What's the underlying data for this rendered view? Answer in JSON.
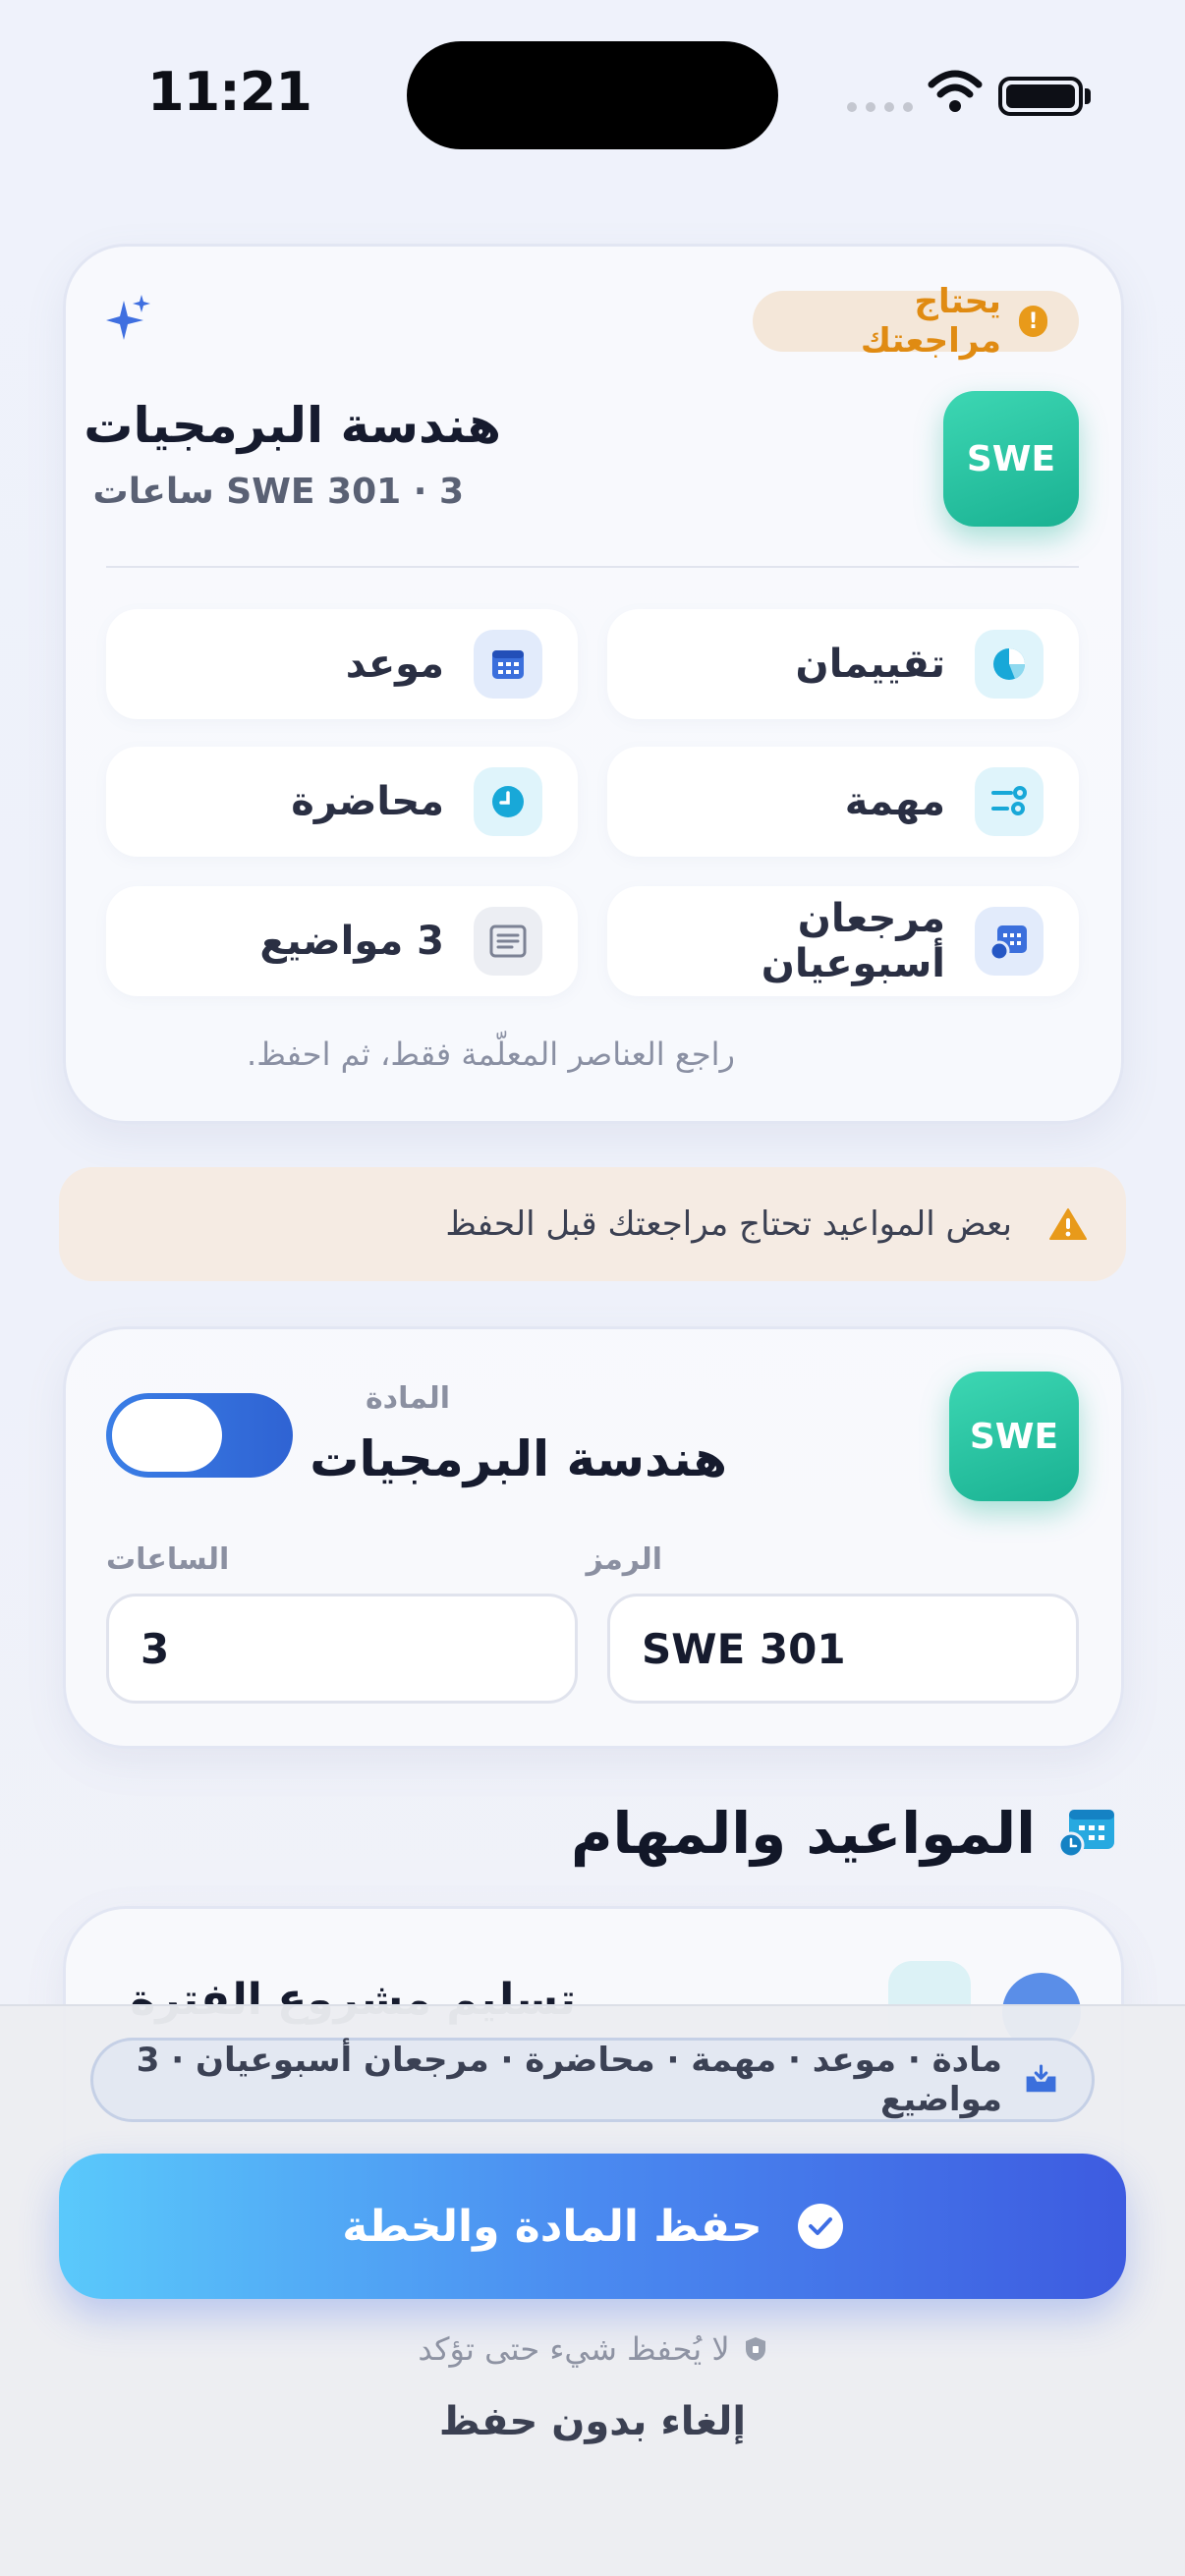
{
  "status_bar": {
    "time": "11:21"
  },
  "summary_card": {
    "review_badge": "يحتاج مراجعتك",
    "badge_code": "SWE",
    "title": "هندسة البرمجيات",
    "subtitle": "SWE 301 · 3 ساعات",
    "tiles": [
      {
        "label": "تقييمان",
        "icon": "pie-chart-icon"
      },
      {
        "label": "موعد",
        "icon": "calendar-icon"
      },
      {
        "label": "مهمة",
        "icon": "task-list-icon"
      },
      {
        "label": "محاضرة",
        "icon": "clock-icon"
      },
      {
        "label": "مرجعان أسبوعيان",
        "icon": "weekly-schedule-icon"
      },
      {
        "label": "3 مواضيع",
        "icon": "topics-icon"
      }
    ],
    "hint": "راجع العناصر المعلّمة فقط، ثم احفظ."
  },
  "warning_banner": {
    "text": "بعض المواعيد تحتاج مراجعتك قبل الحفظ",
    "icon": "warning-icon"
  },
  "course_editor": {
    "badge_code": "SWE",
    "course_label": "المادة",
    "course_name": "هندسة البرمجيات",
    "toggle_on": true,
    "code_label": "الرمز",
    "code_value": "SWE 301",
    "hours_label": "الساعات",
    "hours_value": "3"
  },
  "section": {
    "title": "المواعيد والمهام",
    "icon": "schedule-icon"
  },
  "peek_card": {
    "text": "تسليم مشروع الفترة"
  },
  "bottom_bar": {
    "summary": "مادة · موعد · مهمة · محاضرة · مرجعان أسبوعيان · 3 مواضيع",
    "save_label": "حفظ المادة والخطة",
    "no_save_note": "لا يُحفظ شيء حتى تؤكد",
    "cancel_label": "إلغاء بدون حفظ"
  },
  "colors": {
    "accent_teal": "#1fb596",
    "accent_blue": "#3d5be0",
    "warning": "#e89a1a"
  }
}
